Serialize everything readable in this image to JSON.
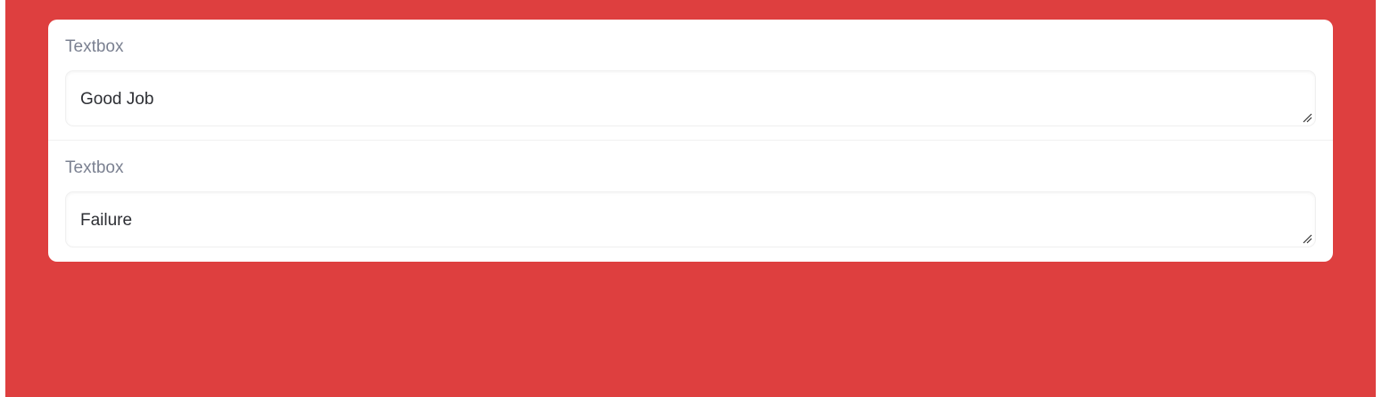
{
  "textboxes": [
    {
      "label": "Textbox",
      "value": "Good Job"
    },
    {
      "label": "Textbox",
      "value": "Failure"
    }
  ],
  "colors": {
    "background": "#de3f3f",
    "panel": "#ffffff",
    "label": "#7b8191",
    "text": "#2d2f34"
  },
  "icons": {
    "resize_handle": "resize-handle-icon"
  }
}
